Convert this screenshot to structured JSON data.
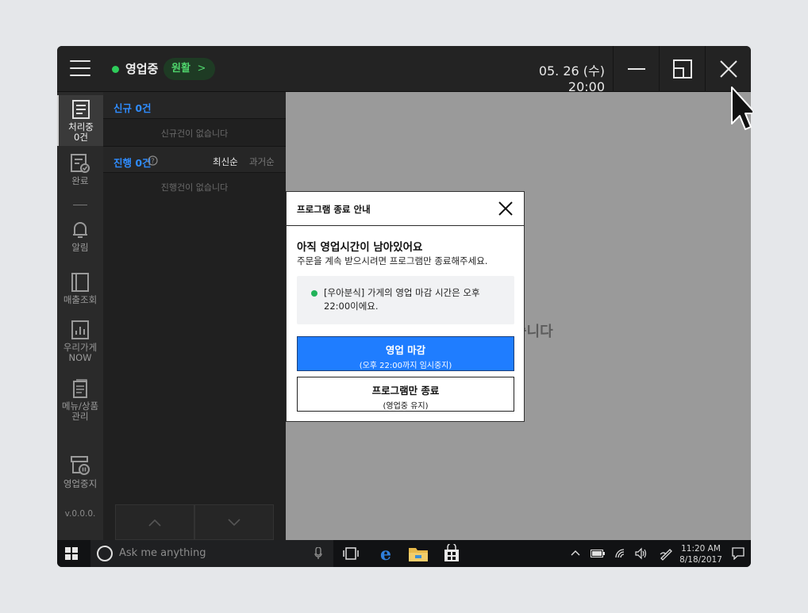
{
  "header": {
    "status_text": "영업중",
    "badge_label": "원활",
    "badge_chevron": ">",
    "datetime": "05. 26 (수) 20:00"
  },
  "sidebar": {
    "items": [
      {
        "label_line1": "처리중",
        "label_line2": "0건",
        "icon": "document-icon"
      },
      {
        "label_line1": "완료",
        "label_line2": "",
        "icon": "document-check-icon"
      },
      {
        "label_line1": "알림",
        "label_line2": "",
        "icon": "bell-icon"
      },
      {
        "label_line1": "매출조회",
        "label_line2": "",
        "icon": "book-icon"
      },
      {
        "label_line1": "우리가게",
        "label_line2": "NOW",
        "icon": "bar-chart-icon"
      },
      {
        "label_line1": "메뉴/상품",
        "label_line2": "관리",
        "icon": "menu-list-icon"
      },
      {
        "label_line1": "영업중지",
        "label_line2": "",
        "icon": "store-pause-icon"
      }
    ],
    "version": "v.0.0.0."
  },
  "orders": {
    "new_title": "신규 0건",
    "new_empty": "신규건이 없습니다",
    "progress_title": "진행 0건",
    "sort_latest": "최신순",
    "sort_oldest": "과거순",
    "progress_empty": "진행건이 없습니다"
  },
  "main": {
    "background_text": "습니다"
  },
  "modal": {
    "title": "프로그램 종료 안내",
    "heading": "아직 영업시간이 남아있어요",
    "description": "주문을 계속 받으시려면 프로그램만 종료해주세요.",
    "notice_text": "[우아분식] 가게의 영업 마감 시간은 오후 22:00이에요.",
    "primary_label": "영업 마감",
    "primary_sub": "(오후 22:00까지 임시중지)",
    "secondary_label": "프로그램만 종료",
    "secondary_sub": "(영업중 유지)"
  },
  "taskbar": {
    "search_placeholder": "Ask me anything",
    "clock_time": "11:20 AM",
    "clock_date": "8/18/2017"
  },
  "colors": {
    "accent_blue": "#1f7dff",
    "status_green": "#2ecc5a",
    "main_bg": "#9a9a9a"
  }
}
